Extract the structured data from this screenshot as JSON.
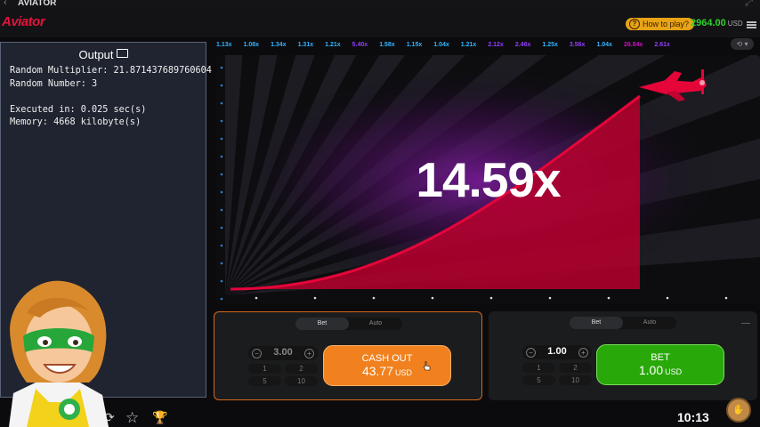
{
  "topbar": {
    "back_icon": "chevron-left-icon",
    "title": "AVIATOR",
    "expand_icon": "expand-icon"
  },
  "header": {
    "logo_text": "Aviator",
    "how_to_play": "How to play?",
    "balance": "2964.00",
    "currency": "USD",
    "menu_icon": "hamburger-menu-icon"
  },
  "history": [
    {
      "value": "1.13x",
      "color": "#34b4ff"
    },
    {
      "value": "1.08x",
      "color": "#34b4ff"
    },
    {
      "value": "1.34x",
      "color": "#34b4ff"
    },
    {
      "value": "1.31x",
      "color": "#34b4ff"
    },
    {
      "value": "1.21x",
      "color": "#34b4ff"
    },
    {
      "value": "5.40x",
      "color": "#913ef8"
    },
    {
      "value": "1.58x",
      "color": "#34b4ff"
    },
    {
      "value": "1.15x",
      "color": "#34b4ff"
    },
    {
      "value": "1.04x",
      "color": "#34b4ff"
    },
    {
      "value": "1.21x",
      "color": "#34b4ff"
    },
    {
      "value": "2.12x",
      "color": "#913ef8"
    },
    {
      "value": "2.46x",
      "color": "#913ef8"
    },
    {
      "value": "1.25x",
      "color": "#34b4ff"
    },
    {
      "value": "3.56x",
      "color": "#913ef8"
    },
    {
      "value": "1.04x",
      "color": "#34b4ff"
    },
    {
      "value": "26.84x",
      "color": "#c017b4"
    },
    {
      "value": "2.61x",
      "color": "#913ef8"
    }
  ],
  "game": {
    "multiplier": "14.59x",
    "curve_color": "#e50539"
  },
  "output": {
    "title": "Output",
    "lines": [
      "Random Multiplier: 21.871437689760604",
      "Random Number: 3",
      "",
      "Executed in: 0.025 sec(s)",
      "Memory: 4668 kilobyte(s)"
    ]
  },
  "panel_left": {
    "tab_bet": "Bet",
    "tab_auto": "Auto",
    "amount": "3.00",
    "quick": [
      "1",
      "2",
      "5",
      "10"
    ],
    "button_line1": "CASH OUT",
    "button_amount": "43.77",
    "button_currency": "USD"
  },
  "panel_right": {
    "tab_bet": "Bet",
    "tab_auto": "Auto",
    "amount": "1.00",
    "quick": [
      "1",
      "2",
      "5",
      "10"
    ],
    "button_line1": "BET",
    "button_amount": "1.00",
    "button_currency": "USD"
  },
  "bottom": {
    "clock": "10:13"
  }
}
